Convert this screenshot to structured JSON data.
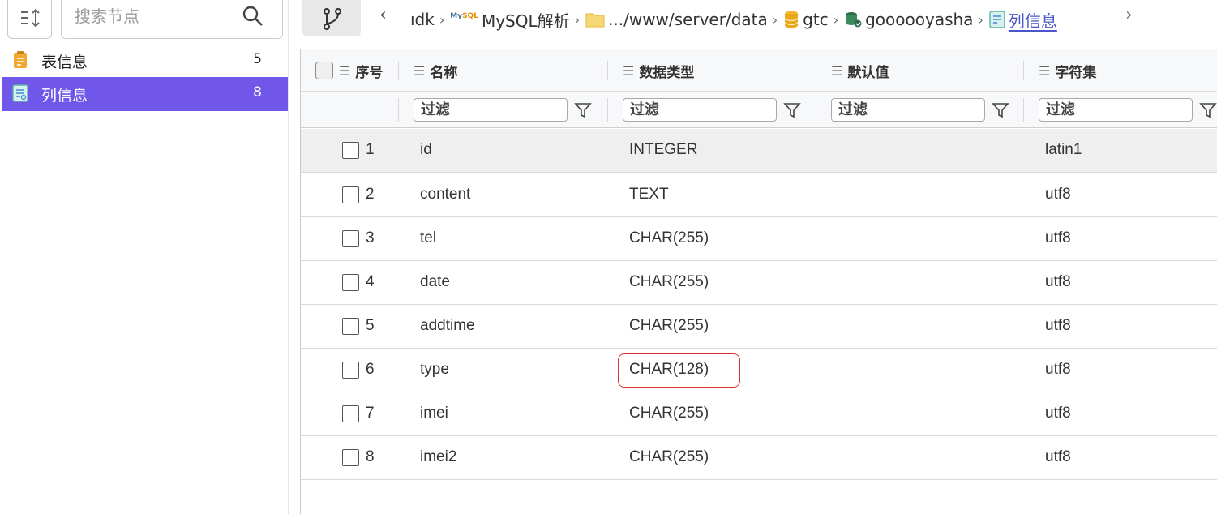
{
  "sidebar": {
    "search_placeholder": "搜索节点",
    "items": [
      {
        "label": "表信息",
        "count": "5",
        "icon": "table-doc-icon"
      },
      {
        "label": "列信息",
        "count": "8",
        "icon": "column-doc-icon"
      }
    ],
    "accent": "#7057ea"
  },
  "breadcrumb": {
    "items": [
      {
        "label": "ıdk",
        "icon": ""
      },
      {
        "label": "MySQL解析",
        "icon": "mysql-logo-icon"
      },
      {
        "label": ".../www/server/data",
        "icon": "folder-icon"
      },
      {
        "label": "gtc",
        "icon": "database-icon"
      },
      {
        "label": "goooooyasha",
        "icon": "schema-icon"
      },
      {
        "label": "列信息",
        "icon": "column-doc-icon"
      }
    ]
  },
  "grid": {
    "columns": [
      "序号",
      "名称",
      "数据类型",
      "默认值",
      "字符集"
    ],
    "filter_placeholder": "过滤",
    "rows": [
      {
        "idx": "1",
        "name": "id",
        "type": "INTEGER",
        "default": "",
        "charset": "latin1"
      },
      {
        "idx": "2",
        "name": "content",
        "type": "TEXT",
        "default": "",
        "charset": "utf8"
      },
      {
        "idx": "3",
        "name": "tel",
        "type": "CHAR(255)",
        "default": "",
        "charset": "utf8"
      },
      {
        "idx": "4",
        "name": "date",
        "type": "CHAR(255)",
        "default": "",
        "charset": "utf8"
      },
      {
        "idx": "5",
        "name": "addtime",
        "type": "CHAR(255)",
        "default": "",
        "charset": "utf8"
      },
      {
        "idx": "6",
        "name": "type",
        "type": "CHAR(128)",
        "default": "",
        "charset": "utf8"
      },
      {
        "idx": "7",
        "name": "imei",
        "type": "CHAR(255)",
        "default": "",
        "charset": "utf8"
      },
      {
        "idx": "8",
        "name": "imei2",
        "type": "CHAR(255)",
        "default": "",
        "charset": "utf8"
      }
    ],
    "selected_row": 1,
    "highlight_color": "#d93030"
  }
}
